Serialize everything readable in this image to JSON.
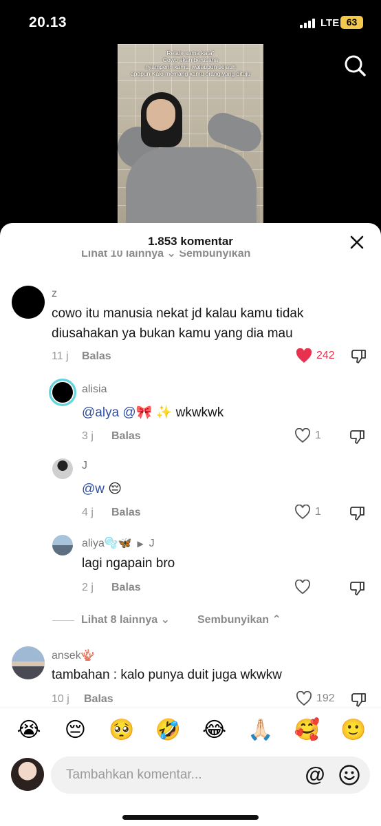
{
  "status_bar": {
    "time": "20.13",
    "network": "LTE",
    "battery": "63"
  },
  "video": {
    "caption_lines": [
      "Relate sama kata\"",
      "Cowo akan berusaha",
      "nyamperin kamu, walaupun sejauh",
      "apapun Kalo memang kamu orang yang dituju"
    ]
  },
  "sheet": {
    "title": "1.853 komentar",
    "cutoff_text": "Lihat 10 lainnya ⌄      Sembunyikan"
  },
  "comments": [
    {
      "user": "z",
      "text_lines": [
        "cowo itu manusia nekat jd kalau kamu tidak",
        "diusahakan ya bukan kamu yang dia mau"
      ],
      "time": "11 j",
      "reply": "Balas",
      "likes": "242"
    },
    {
      "user": "alisia",
      "mention": "@alya @🎀 ✨",
      "text": " wkwkwk",
      "time": "3 j",
      "reply": "Balas",
      "likes": "1"
    },
    {
      "user": "J",
      "mention": "@w",
      "text": " 😔",
      "time": "4 j",
      "reply": "Balas",
      "likes": "1"
    },
    {
      "user": "aliya🫧🦋",
      "reply_to": "J",
      "text": "lagi ngapain bro",
      "time": "2 j",
      "reply": "Balas",
      "likes": ""
    },
    {
      "user": "ansek🪸",
      "text": "tambahan : kalo punya duit juga wkwkw",
      "time": "10 j",
      "reply": "Balas",
      "likes": "192"
    }
  ],
  "more_replies": {
    "label": "Lihat 8 lainnya",
    "hide": "Sembunyikan"
  },
  "emoji_bar": [
    "😭",
    "😔",
    "🥺",
    "🤣",
    "😂",
    "🙏🏻",
    "🥰",
    "🙂"
  ],
  "input": {
    "placeholder": "Tambahkan komentar...",
    "at_symbol": "@"
  },
  "colors": {
    "like_red": "#e8304f",
    "mention_blue": "#2f4fa2",
    "battery": "#f2c94c"
  }
}
